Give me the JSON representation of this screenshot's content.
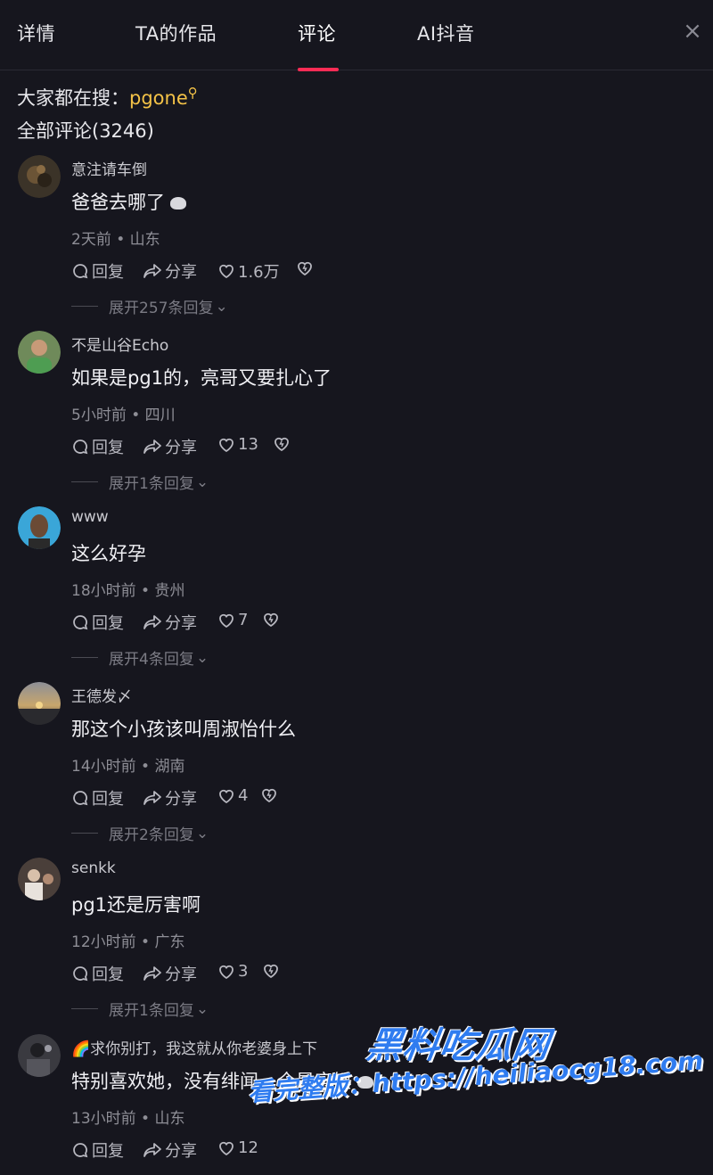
{
  "tabs": [
    {
      "label": "详情"
    },
    {
      "label": "TA的作品"
    },
    {
      "label": "评论"
    },
    {
      "label": "AI抖音"
    }
  ],
  "active_tab": "评论",
  "close_symbol": "×",
  "search_hint": {
    "prefix": "大家都在搜：",
    "keyword": "pgone",
    "icon": "search-icon"
  },
  "comment_count_label": "全部评论(3246)",
  "actions": {
    "reply": "回复",
    "share": "分享"
  },
  "comments": [
    {
      "user": "意注请车倒",
      "text": "爸爸去哪了",
      "emoji": true,
      "meta": "2天前 • 山东",
      "likes": "1.6万",
      "expand": "展开257条回复"
    },
    {
      "user": "不是山谷Echo",
      "text": "如果是pg1的，亮哥又要扎心了",
      "emoji": false,
      "meta": "5小时前 • 四川",
      "likes": "13",
      "expand": "展开1条回复"
    },
    {
      "user": "www",
      "text": "这么好孕",
      "emoji": false,
      "meta": "18小时前 • 贵州",
      "likes": "7",
      "expand": "展开4条回复"
    },
    {
      "user": "王德发〆",
      "text": "那这个小孩该叫周淑怡什么",
      "emoji": false,
      "meta": "14小时前 • 湖南",
      "likes": "4",
      "expand": "展开2条回复"
    },
    {
      "user": "senkk",
      "text": "pg1还是厉害啊",
      "emoji": false,
      "meta": "12小时前 • 广东",
      "likes": "3",
      "expand": "展开1条回复"
    },
    {
      "user": "🌈求你别打，我这就从你老婆身上下",
      "text": "特别喜欢她，没有绯闻，全是实锤",
      "emoji": true,
      "meta": "13小时前 • 山东",
      "likes": "12",
      "expand": ""
    }
  ],
  "watermark": {
    "line1": "黑料吃瓜网",
    "line2": "看完整版：https://heiliaocg18.com"
  },
  "colors": {
    "background": "#16161e",
    "accent": "#fe2c55",
    "search_keyword": "#f3c247",
    "watermark": "#2f7cf0"
  }
}
